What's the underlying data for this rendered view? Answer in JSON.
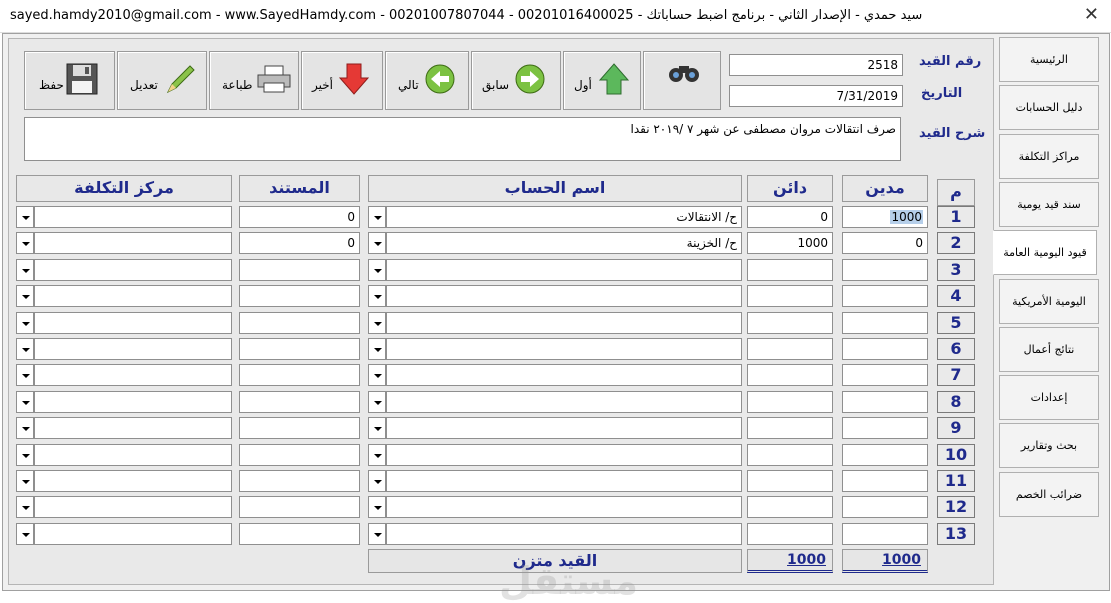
{
  "window": {
    "title": "sayed.hamdy2010@gmail.com - www.SayedHamdy.com - 00201007807044 - 00201016400025 - سيد حمدي - الإصدار الثاني - برنامج اضبط حساباتك",
    "close_icon": "close-icon"
  },
  "toolbar": {
    "save": "حفظ",
    "edit": "تعديل",
    "print": "طباعة",
    "last": "أخير",
    "next": "تالي",
    "prev": "سابق",
    "first": "أول",
    "icons": {
      "save": "floppy-icon",
      "edit": "pencil-icon",
      "print": "printer-icon",
      "last": "arrow-down-icon",
      "next": "arrow-left-icon",
      "prev": "arrow-right-icon",
      "first": "arrow-up-icon",
      "search": "binoculars-icon"
    }
  },
  "entry": {
    "number_label": "رقم القيد",
    "number": "2518",
    "date_label": "التاريخ",
    "date": "7/31/2019",
    "desc_label": "شرح القيد",
    "desc": "صرف انتقالات مروان مصطفى عن شهر ٧ /٢٠١٩ نقدا"
  },
  "grid": {
    "headers": {
      "m": "م",
      "debit": "مدين",
      "credit": "دائن",
      "account": "اسم الحساب",
      "document": "المستند",
      "cost_center": "مركز التكلفة"
    },
    "rows": [
      {
        "n": "1",
        "debit": "1000",
        "credit": "0",
        "account": "ح/ الانتقالات",
        "document": "0",
        "cost_center": ""
      },
      {
        "n": "2",
        "debit": "0",
        "credit": "1000",
        "account": "ح/ الخزينة",
        "document": "0",
        "cost_center": ""
      },
      {
        "n": "3",
        "debit": "",
        "credit": "",
        "account": "",
        "document": "",
        "cost_center": ""
      },
      {
        "n": "4",
        "debit": "",
        "credit": "",
        "account": "",
        "document": "",
        "cost_center": ""
      },
      {
        "n": "5",
        "debit": "",
        "credit": "",
        "account": "",
        "document": "",
        "cost_center": ""
      },
      {
        "n": "6",
        "debit": "",
        "credit": "",
        "account": "",
        "document": "",
        "cost_center": ""
      },
      {
        "n": "7",
        "debit": "",
        "credit": "",
        "account": "",
        "document": "",
        "cost_center": ""
      },
      {
        "n": "8",
        "debit": "",
        "credit": "",
        "account": "",
        "document": "",
        "cost_center": ""
      },
      {
        "n": "9",
        "debit": "",
        "credit": "",
        "account": "",
        "document": "",
        "cost_center": ""
      },
      {
        "n": "10",
        "debit": "",
        "credit": "",
        "account": "",
        "document": "",
        "cost_center": ""
      },
      {
        "n": "11",
        "debit": "",
        "credit": "",
        "account": "",
        "document": "",
        "cost_center": ""
      },
      {
        "n": "12",
        "debit": "",
        "credit": "",
        "account": "",
        "document": "",
        "cost_center": ""
      },
      {
        "n": "13",
        "debit": "",
        "credit": "",
        "account": "",
        "document": "",
        "cost_center": ""
      }
    ],
    "total_debit": "1000",
    "total_credit": "1000",
    "status": "القيد متزن"
  },
  "sidebar": {
    "items": [
      "الرئيسية",
      "دليل الحسابات",
      "مراكز التكلفة",
      "سند قيد يومية",
      "قيود اليومية العامة",
      "اليومية الأمريكية",
      "نتائج أعمال",
      "إعدادات",
      "بحث وتقارير",
      "ضرائب الخصم"
    ],
    "active_index": 4
  },
  "watermark": "مستقل",
  "colors": {
    "label_blue": "#1f2a8c",
    "selection": "#b6cfea"
  }
}
